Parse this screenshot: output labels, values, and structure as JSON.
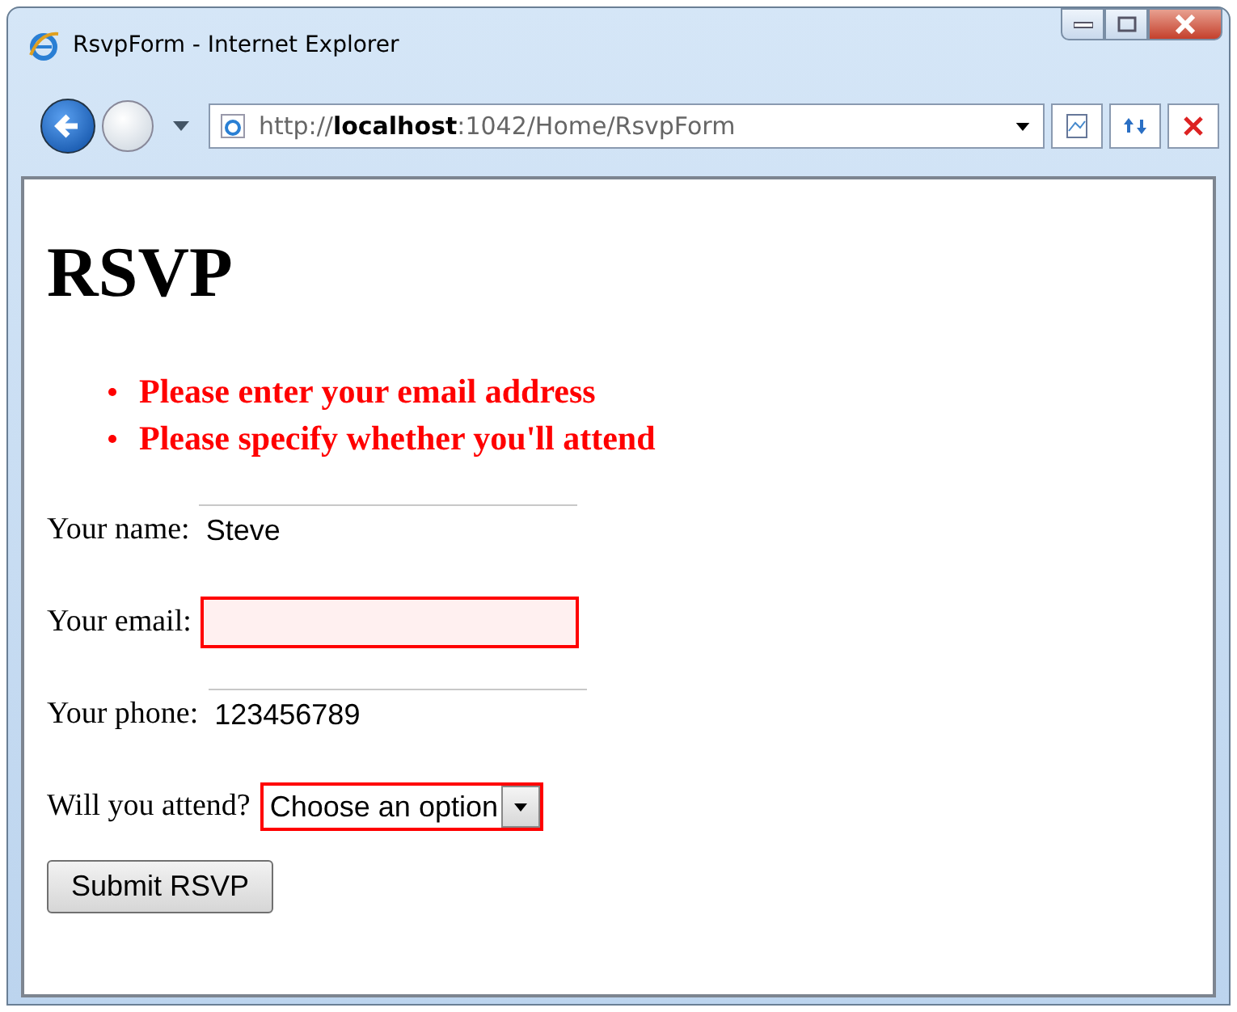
{
  "window": {
    "title": "RsvpForm - Internet Explorer"
  },
  "address_bar": {
    "url": "http://**localhost**:1042/Home/RsvpForm"
  },
  "page": {
    "heading": "RSVP",
    "errors": [
      "Please enter your email address",
      "Please specify whether you'll attend"
    ],
    "fields": [
      {
        "kind": "text",
        "label": "Your name:",
        "value": "Steve",
        "invalid": false
      },
      {
        "kind": "text",
        "label": "Your email:",
        "invalid": true
      },
      {
        "kind": "text",
        "label": "Your phone:",
        "value": "123456789",
        "invalid": false
      },
      {
        "kind": "select",
        "label": "Will you attend?",
        "value": "Choose an option",
        "invalid": true
      }
    ],
    "submit": "Submit RSVP"
  }
}
